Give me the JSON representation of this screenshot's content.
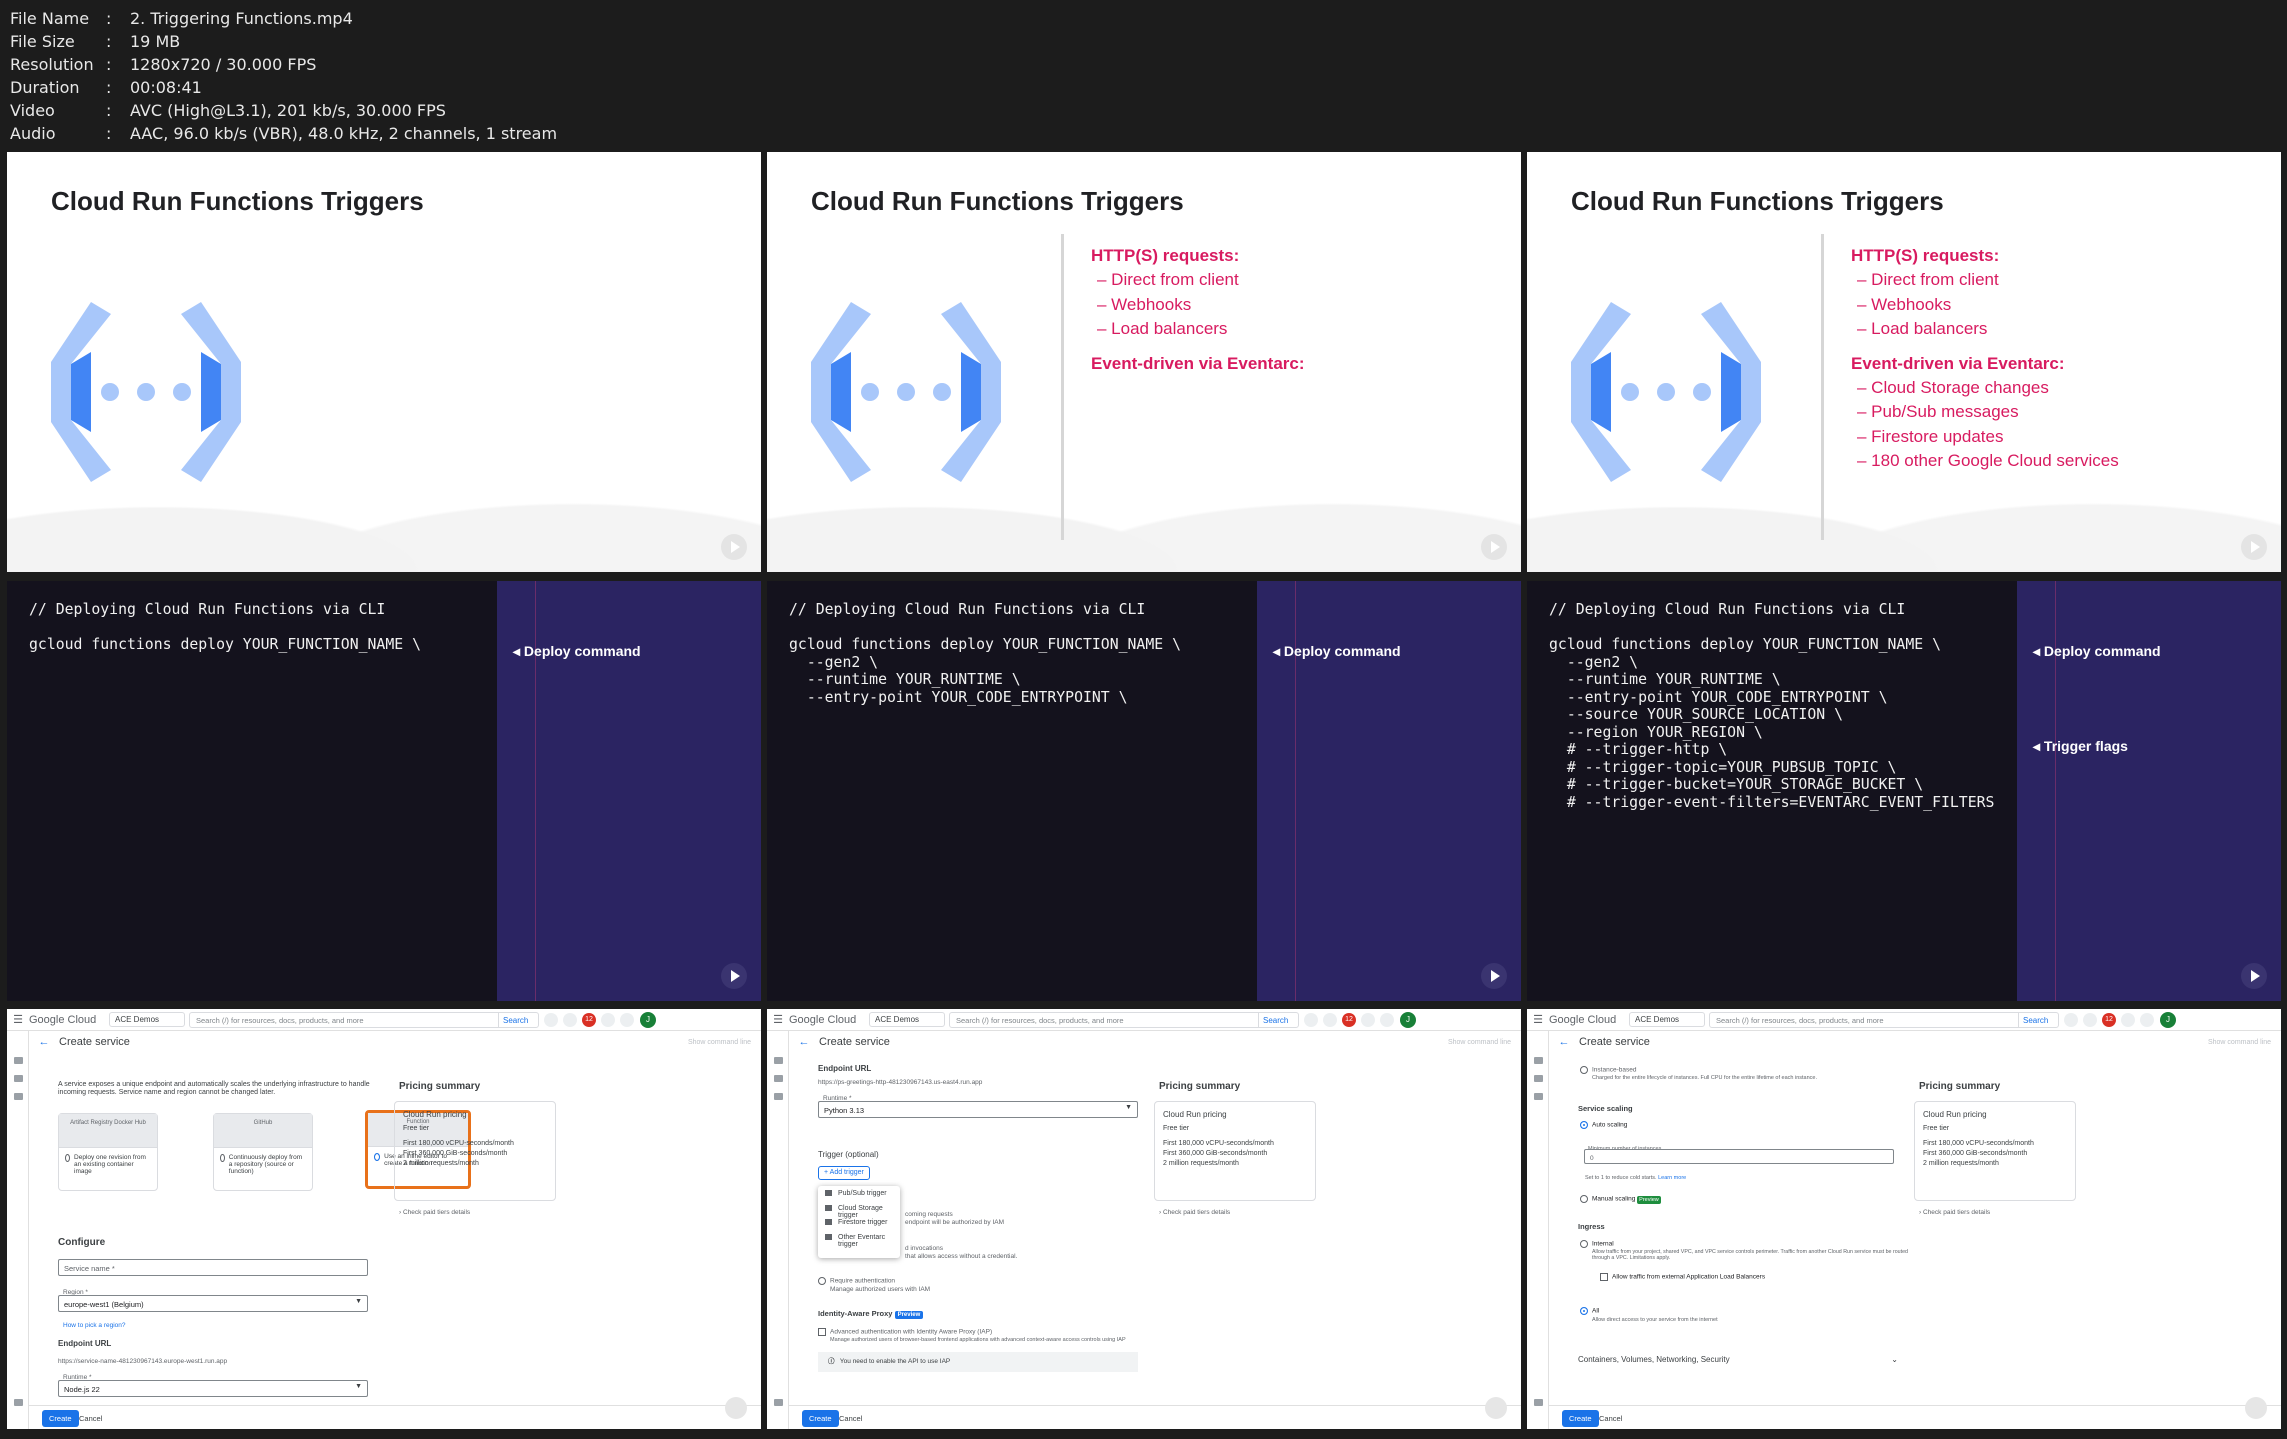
{
  "file_info": [
    {
      "label": "File Name",
      "value": "2. Triggering Functions.mp4"
    },
    {
      "label": "File Size",
      "value": "19 MB"
    },
    {
      "label": "Resolution",
      "value": "1280x720 / 30.000 FPS"
    },
    {
      "label": "Duration",
      "value": "00:08:41"
    },
    {
      "label": "Video",
      "value": "AVC (High@L3.1), 201 kb/s, 30.000 FPS"
    },
    {
      "label": "Audio",
      "value": "AAC, 96.0 kb/s (VBR), 48.0 kHz, 2 channels, 1 stream"
    }
  ],
  "slides": {
    "title": "Cloud Run Functions Triggers",
    "http_heading": "HTTP(S) requests:",
    "http_items": [
      "– Direct from client",
      "– Webhooks",
      "– Load balancers"
    ],
    "event_heading": "Event-driven via Eventarc:",
    "event_items": [
      "– Cloud Storage changes",
      "– Pub/Sub messages",
      "– Firestore updates",
      "– 180 other Google Cloud services"
    ]
  },
  "code": {
    "comment": "// Deploying Cloud Run Functions via CLI",
    "block1": "gcloud functions deploy YOUR_FUNCTION_NAME \\",
    "block2": "gcloud functions deploy YOUR_FUNCTION_NAME \\\n  --gen2 \\\n  --runtime YOUR_RUNTIME \\\n  --entry-point YOUR_CODE_ENTRYPOINT \\",
    "block3": "gcloud functions deploy YOUR_FUNCTION_NAME \\\n  --gen2 \\\n  --runtime YOUR_RUNTIME \\\n  --entry-point YOUR_CODE_ENTRYPOINT \\\n  --source YOUR_SOURCE_LOCATION \\\n  --region YOUR_REGION \\\n  # --trigger-http \\\n  # --trigger-topic=YOUR_PUBSUB_TOPIC \\\n  # --trigger-bucket=YOUR_STORAGE_BUCKET \\\n  # --trigger-event-filters=EVENTARC_EVENT_FILTERS",
    "callout_deploy": "◂ Deploy command",
    "callout_trigger": "◂ Trigger flags"
  },
  "console": {
    "logo": "Google Cloud",
    "project": "ACE Demos",
    "search_placeholder": "Search (/) for resources, docs, products, and more",
    "search_btn": "Search",
    "badge": "12",
    "avatar": "J",
    "page_title": "Create service",
    "show_cmd": "Show command line",
    "pricing_title": "Pricing summary",
    "pricing_card_title": "Cloud Run pricing",
    "pricing_free": "Free tier",
    "pricing_lines": [
      "First 180,000 vCPU-seconds/month",
      "First 360,000 GiB-seconds/month",
      "2 million requests/month"
    ],
    "pricing_link": "Check paid tiers details",
    "create_btn": "Create",
    "cancel_btn": "Cancel"
  },
  "panel1": {
    "intro": "A service exposes a unique endpoint and automatically scales the underlying infrastructure to handle incoming requests. Service name and region cannot be changed later.",
    "card1_top": "Artifact Registry   Docker Hub",
    "card1_text": "Deploy one revision from an existing container image",
    "card2_top": "GitHub",
    "card2_text": "Continuously deploy from a repository (source or function)",
    "card3_top": "Function",
    "card3_text": "Use an inline editor to create a function",
    "configure": "Configure",
    "service_name_ph": "Service name *",
    "region_label": "Region *",
    "region_value": "europe-west1 (Belgium)",
    "region_help": "How to pick a region?",
    "endpoint_label": "Endpoint URL",
    "endpoint_value": "https://service-name-481230967143.europe-west1.run.app",
    "runtime_label": "Runtime *",
    "runtime_value": "Node.js 22"
  },
  "panel2": {
    "endpoint_label": "Endpoint URL",
    "endpoint_value": "https://ps-greetings-http-481230967143.us-east4.run.app",
    "runtime_label": "Runtime *",
    "runtime_value": "Python 3.13",
    "trigger_label": "Trigger (optional)",
    "add_trigger": "+ Add trigger",
    "menu": [
      "Pub/Sub trigger",
      "Cloud Storage trigger",
      "Firestore trigger",
      "Other Eventarc trigger"
    ],
    "auth_frag1": "coming requests",
    "auth_frag2": "endpoint will be authorized by IAM",
    "auth_frag3": "d invocations",
    "auth_frag4": "that allows access without a credential.",
    "req_auth": "Require authentication",
    "req_auth_sub": "Manage authorized users with IAM",
    "iap_label": "Identity-Aware Proxy",
    "iap_badge": "Preview",
    "iap_check": "Advanced authentication with Identity Aware Proxy (IAP)",
    "iap_sub": "Manage authorized users of browser-based frontend applications with advanced context-aware access controls using IAP",
    "iap_notice": "You need to enable the API to use IAP"
  },
  "panel3": {
    "instance_based": "Instance-based",
    "instance_sub": "Charged for the entire lifecycle of instances. Full CPU for the entire lifetime of each instance.",
    "scaling_label": "Service scaling",
    "auto_scaling": "Auto scaling",
    "min_label": "Minimum number of instances",
    "min_value": "0",
    "min_help": "Set to 1 to reduce cold starts.",
    "learn_more": "Learn more",
    "manual_scaling": "Manual scaling",
    "preview": "Preview",
    "ingress_label": "Ingress",
    "internal": "Internal",
    "internal_sub": "Allow traffic from your project, shared VPC, and VPC service controls perimeter. Traffic from another Cloud Run service must be routed through a VPC. Limitations apply.",
    "allow_lb": "Allow traffic from external Application Load Balancers",
    "all": "All",
    "all_sub": "Allow direct access to your service from the internet",
    "containers": "Containers, Volumes, Networking, Security"
  }
}
